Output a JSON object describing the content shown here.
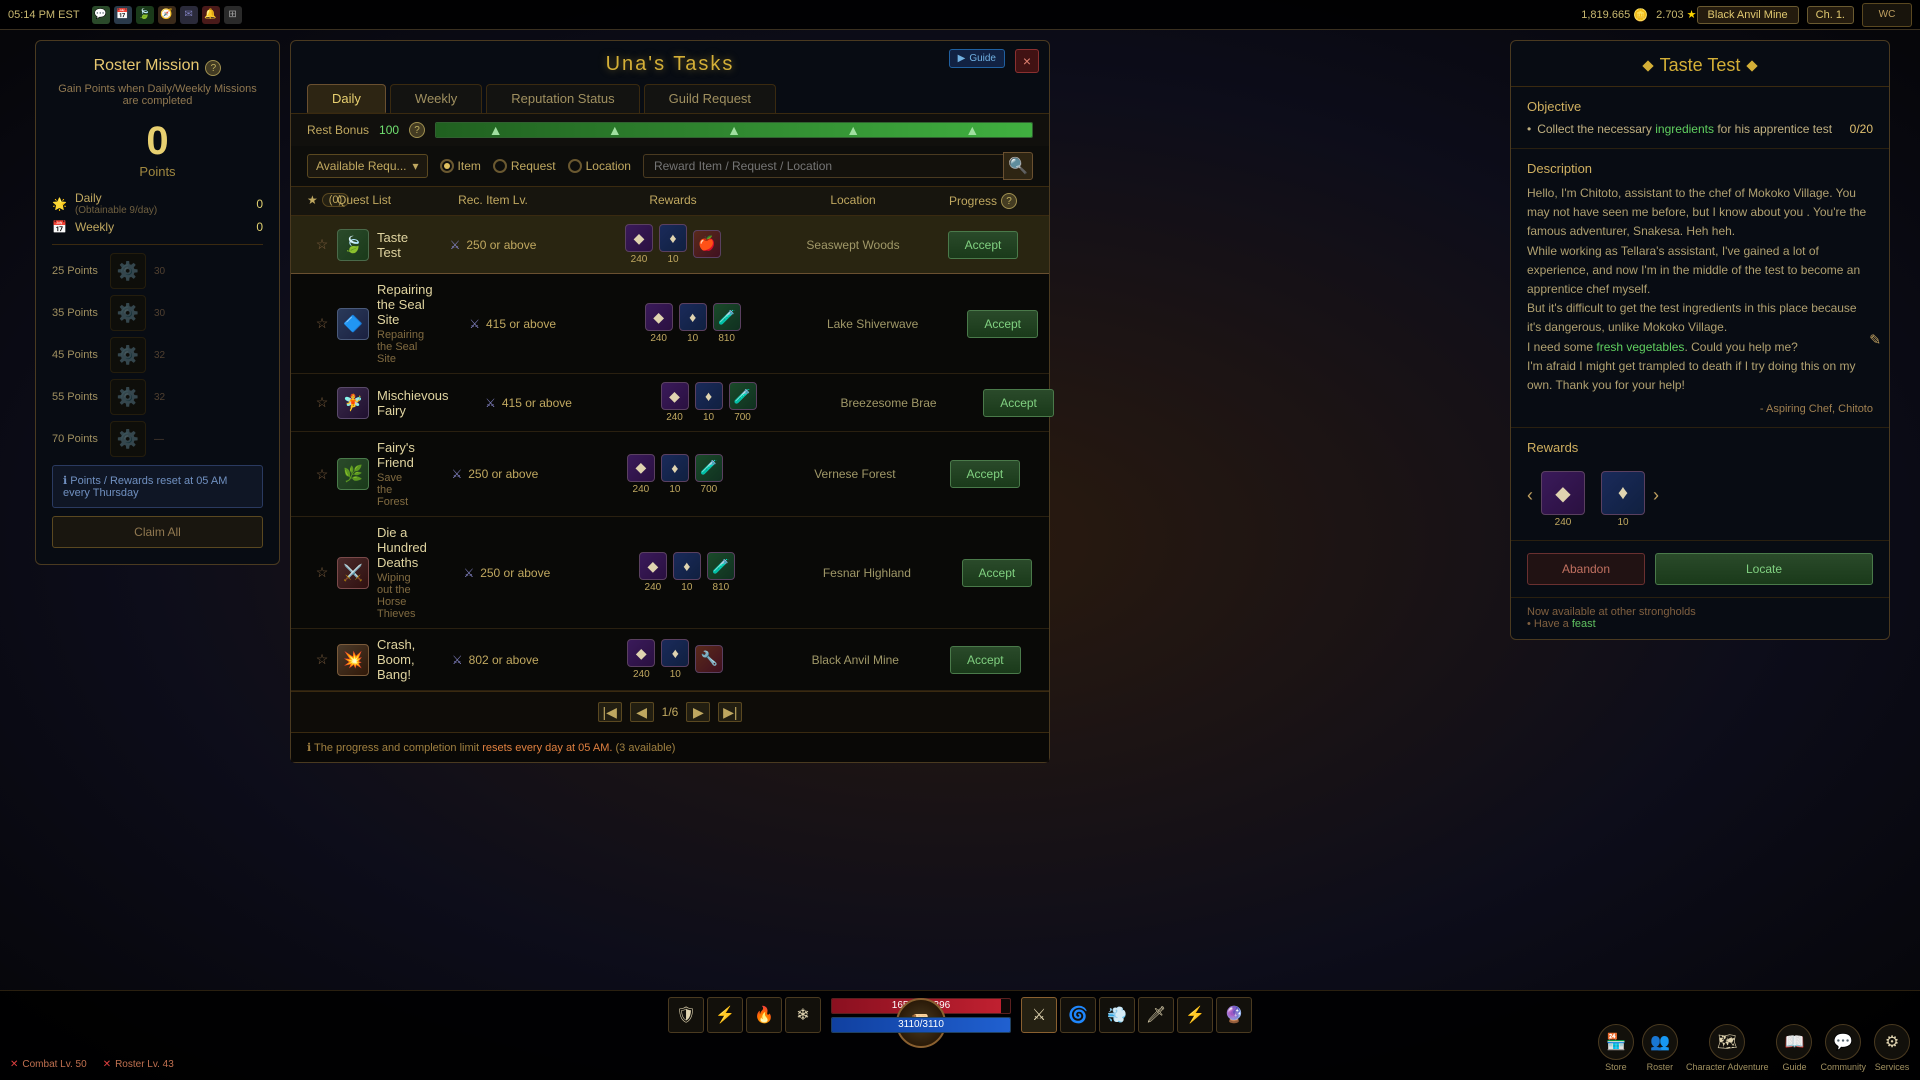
{
  "app": {
    "time": "05:14 PM EST",
    "location": "Black Anvil Mine",
    "chapter": "Ch. 1."
  },
  "dialog": {
    "title": "Una's Tasks",
    "close_label": "×",
    "guide_label": "▶ Guide",
    "tabs": [
      "Daily",
      "Weekly",
      "Reputation Status",
      "Guild Request"
    ],
    "active_tab": 0
  },
  "filter": {
    "rest_bonus_label": "Rest Bonus",
    "rest_bonus_value": "100",
    "help_icon": "?",
    "filter_placeholder": "Available Requ...",
    "radio_options": [
      "Item",
      "Request",
      "Location"
    ],
    "active_radio": 0,
    "search_placeholder": "Reward Item / Request / Location"
  },
  "table": {
    "columns": [
      "★ (0)",
      "Quest List",
      "Rec. Item Lv.",
      "Rewards",
      "Location",
      "Progress ?"
    ],
    "quests": [
      {
        "id": 1,
        "selected": true,
        "starred": false,
        "name": "Taste Test",
        "subtitle": "",
        "item_lv": "250 or above",
        "rewards": [
          {
            "type": "purple",
            "icon": "◆",
            "count": "240"
          },
          {
            "type": "blue",
            "icon": "♦",
            "count": "10"
          },
          {
            "type": "red",
            "icon": "🍎",
            "count": ""
          }
        ],
        "location": "Seaswept Woods",
        "action": "Accept"
      },
      {
        "id": 2,
        "selected": false,
        "starred": false,
        "name": "Repairing the Seal Site",
        "subtitle": "Repairing the Seal Site",
        "item_lv": "415 or above",
        "rewards": [
          {
            "type": "purple",
            "icon": "◆",
            "count": "240"
          },
          {
            "type": "blue",
            "icon": "♦",
            "count": "10"
          },
          {
            "type": "green",
            "icon": "🧪",
            "count": "810"
          }
        ],
        "location": "Lake Shiverwave",
        "action": "Accept"
      },
      {
        "id": 3,
        "selected": false,
        "starred": false,
        "name": "Mischievous Fairy",
        "subtitle": "",
        "item_lv": "415 or above",
        "rewards": [
          {
            "type": "purple",
            "icon": "◆",
            "count": "240"
          },
          {
            "type": "blue",
            "icon": "♦",
            "count": "10"
          },
          {
            "type": "green",
            "icon": "🧪",
            "count": "700"
          }
        ],
        "location": "Breezesome Brae",
        "action": "Accept"
      },
      {
        "id": 4,
        "selected": false,
        "starred": false,
        "name": "Fairy's Friend",
        "subtitle": "Save the Forest",
        "item_lv": "250 or above",
        "rewards": [
          {
            "type": "purple",
            "icon": "◆",
            "count": "240"
          },
          {
            "type": "blue",
            "icon": "♦",
            "count": "10"
          },
          {
            "type": "green",
            "icon": "🧪",
            "count": "700"
          }
        ],
        "location": "Vernese Forest",
        "action": "Accept"
      },
      {
        "id": 5,
        "selected": false,
        "starred": false,
        "name": "Die a Hundred Deaths",
        "subtitle": "Wiping out the Horse Thieves",
        "item_lv": "250 or above",
        "rewards": [
          {
            "type": "purple",
            "icon": "◆",
            "count": "240"
          },
          {
            "type": "blue",
            "icon": "♦",
            "count": "10"
          },
          {
            "type": "green",
            "icon": "🧪",
            "count": "810"
          }
        ],
        "location": "Fesnar Highland",
        "action": "Accept"
      },
      {
        "id": 6,
        "selected": false,
        "starred": false,
        "name": "Crash, Boom, Bang!",
        "subtitle": "",
        "item_lv": "802 or above",
        "rewards": [
          {
            "type": "purple",
            "icon": "◆",
            "count": "240"
          },
          {
            "type": "blue",
            "icon": "♦",
            "count": "10"
          },
          {
            "type": "red",
            "icon": "🍎",
            "count": ""
          }
        ],
        "location": "Black Anvil Mine",
        "action": "Accept"
      }
    ],
    "page": "1/6"
  },
  "footer": {
    "notice": "The progress and completion limit resets every day at 05 AM. (3 available)"
  },
  "roster": {
    "title": "Roster Mission",
    "help": "?",
    "subtitle": "Gain Points when Daily/Weekly Missions are completed",
    "points": "0",
    "points_label": "Points",
    "missions": [
      {
        "icon": "🌟",
        "label": "Daily",
        "sublabel": "(Obtainable 9/day)",
        "count": "0"
      },
      {
        "icon": "📅",
        "label": "Weekly",
        "sublabel": "",
        "count": "0"
      }
    ],
    "tiers": [
      {
        "points": "25",
        "label": "Points"
      },
      {
        "points": "35",
        "label": "Points"
      },
      {
        "points": "45",
        "label": "Points"
      },
      {
        "points": "55",
        "label": "Points"
      },
      {
        "points": "70",
        "label": "Points"
      }
    ],
    "reset_notice": "Points / Rewards reset at 05 AM every Thursday",
    "claim_all": "Claim All"
  },
  "detail": {
    "title": "Taste Test",
    "objective_title": "Objective",
    "objective": "Collect the necessary ingredients for his apprentice test",
    "objective_progress": "0/20",
    "description_title": "Description",
    "description": "Hello, I'm Chitoto, assistant to the chef of Mokoko Village. You may not have seen me before, but I know about you. You're the famous adventurer, Snakesa. Heh heh.\nWhile working as Tellara's assistant, I've gained a lot of experience, and now I'm in the middle of the test to become an apprentice chef myself.\nBut it's difficult to get the test ingredients in this place because it's dangerous, unlike Mokoko Village.\nI need some fresh vegetables. Could you help me?\nI'm afraid I might get trampled to death if I try doing this on my own. Thank you for your help!",
    "desc_highlight1": "fresh vegetables",
    "signature": "- Aspiring Chef, Chitoto",
    "rewards_title": "Rewards",
    "rewards": [
      {
        "type": "purple",
        "icon": "◆",
        "count": "240"
      },
      {
        "type": "blue",
        "icon": "♦",
        "count": "10"
      }
    ],
    "abandon_label": "Abandon",
    "locate_label": "Locate"
  },
  "bottom_hud": {
    "health": "16509/17396",
    "mana": "3110/3110",
    "combat_lv": "Combat Lv. 50",
    "roster_lv": "Roster Lv. 43",
    "bottom_icons": [
      "Store",
      "Roster",
      "Character Adventure",
      "Guide",
      "Community",
      "Services"
    ]
  }
}
